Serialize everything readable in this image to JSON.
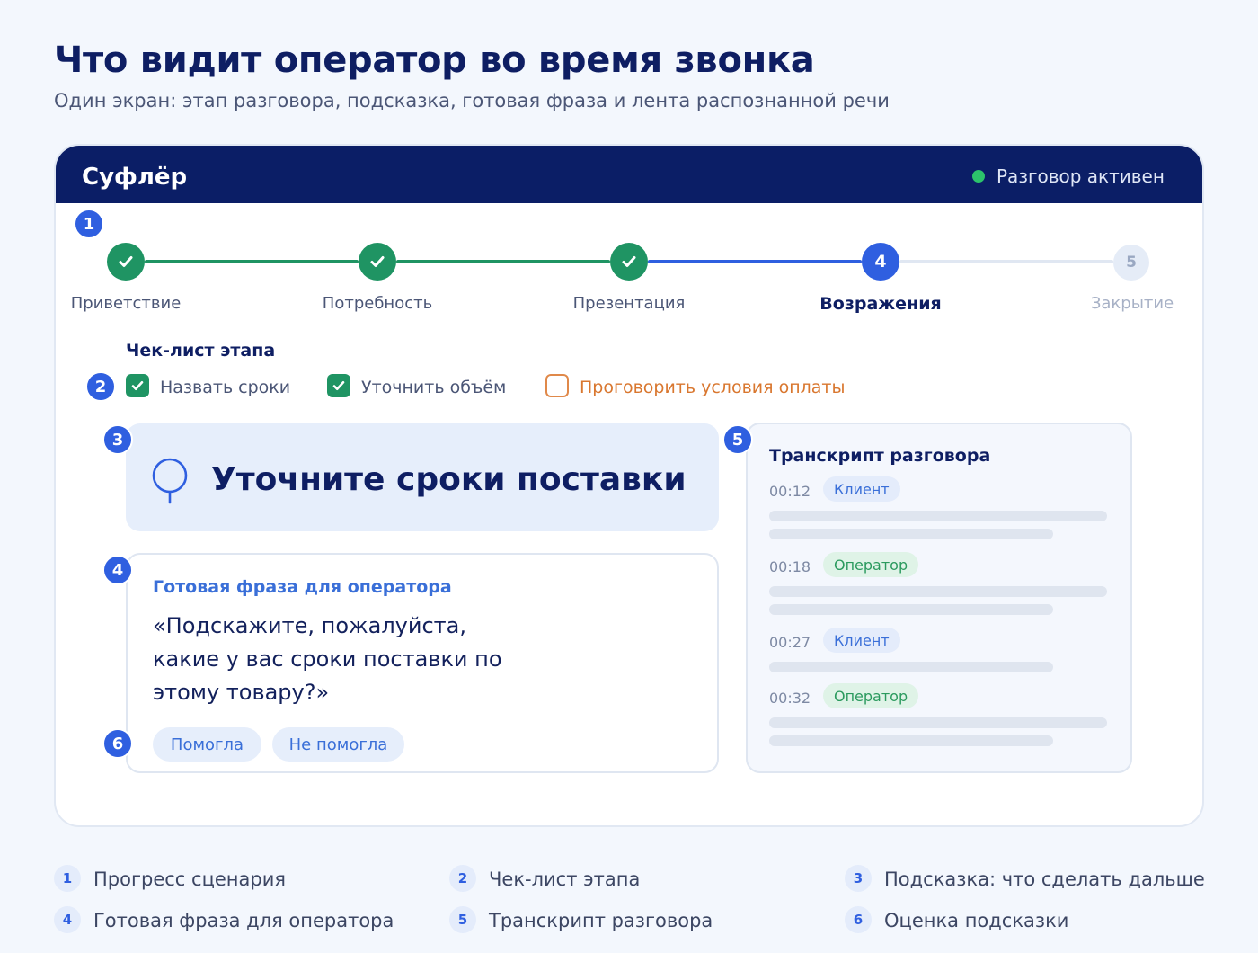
{
  "header": {
    "title": "Что видит оператор во время звонка",
    "subtitle": "Один экран: этап разговора, подсказка, готовая фраза и лента распознанной речи"
  },
  "app": {
    "title": "Суфлёр",
    "status": "Разговор активен",
    "status_color": "#2cc36b"
  },
  "markers": [
    "1",
    "2",
    "3",
    "4",
    "5",
    "6"
  ],
  "stepper": {
    "steps": [
      {
        "label": "Приветствие",
        "state": "done",
        "number": ""
      },
      {
        "label": "Потребность",
        "state": "done",
        "number": ""
      },
      {
        "label": "Презентация",
        "state": "done",
        "number": ""
      },
      {
        "label": "Возражения",
        "state": "active",
        "number": "4"
      },
      {
        "label": "Закрытие",
        "state": "todo",
        "number": "5"
      }
    ]
  },
  "checklist": {
    "title": "Чек-лист этапа",
    "items": [
      {
        "label": "Назвать сроки",
        "checked": true
      },
      {
        "label": "Уточнить объём",
        "checked": true
      },
      {
        "label": "Проговорить условия оплаты",
        "checked": false
      }
    ]
  },
  "hint": {
    "text": "Уточните сроки поставки",
    "icon": "lightbulb-icon"
  },
  "phrase": {
    "title": "Готовая фраза для оператора",
    "text": "«Подскажите, пожалуйста, какие у вас сроки поставки по этому товару?»",
    "helped_label": "Помогла",
    "not_helped_label": "Не помогла"
  },
  "transcript": {
    "title": "Транскрипт разговора",
    "entries": [
      {
        "time": "00:12",
        "speaker": "Клиент"
      },
      {
        "time": "00:18",
        "speaker": "Оператор"
      },
      {
        "time": "00:27",
        "speaker": "Клиент"
      },
      {
        "time": "00:32",
        "speaker": "Оператор"
      }
    ]
  },
  "legend": [
    {
      "num": "1",
      "text": "Прогресс сценария"
    },
    {
      "num": "2",
      "text": "Чек-лист этапа"
    },
    {
      "num": "3",
      "text": "Подсказка: что сделать дальше"
    },
    {
      "num": "4",
      "text": "Готовая фраза для оператора"
    },
    {
      "num": "5",
      "text": "Транскрипт разговора"
    },
    {
      "num": "6",
      "text": "Оценка подсказки"
    }
  ],
  "colors": {
    "navy": "#0b1e66",
    "accent_blue": "#2f5fe0",
    "done_green": "#1f9463",
    "pending_orange": "#d9772f"
  }
}
